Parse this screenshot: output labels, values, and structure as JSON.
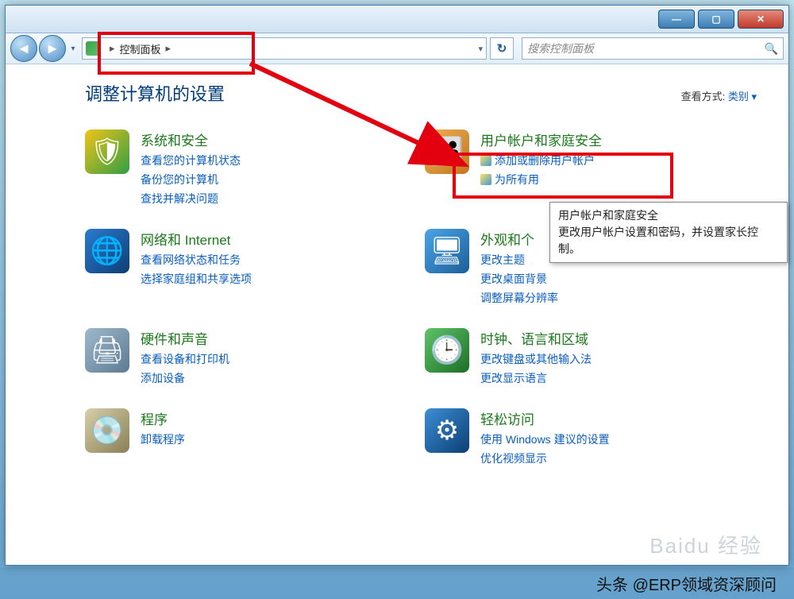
{
  "titlebar": {
    "minimize_glyph": "—",
    "maximize_glyph": "▢",
    "close_glyph": "✕"
  },
  "toolbar": {
    "back_glyph": "◄",
    "fwd_glyph": "►",
    "history_caret": "▾",
    "breadcrumb_root": "控制面板",
    "breadcrumb_sep": "▸",
    "address_caret": "▾",
    "refresh_glyph": "↻",
    "search_placeholder": "搜索控制面板",
    "search_glyph": "🔍"
  },
  "header": {
    "title": "调整计算机的设置",
    "viewby_label": "查看方式:",
    "viewby_value": "类别 ▾"
  },
  "categories": {
    "system": {
      "title": "系统和安全",
      "links": [
        "查看您的计算机状态",
        "备份您的计算机",
        "查找并解决问题"
      ]
    },
    "network": {
      "title": "网络和 Internet",
      "links": [
        "查看网络状态和任务",
        "选择家庭组和共享选项"
      ]
    },
    "hardware": {
      "title": "硬件和声音",
      "links": [
        "查看设备和打印机",
        "添加设备"
      ]
    },
    "programs": {
      "title": "程序",
      "links": [
        "卸载程序"
      ]
    },
    "users": {
      "title": "用户帐户和家庭安全",
      "links": [
        "添加或删除用户帐户",
        "为所有用"
      ]
    },
    "appearance": {
      "title": "外观和个",
      "links": [
        "更改主题",
        "更改桌面背景",
        "调整屏幕分辨率"
      ]
    },
    "clock": {
      "title": "时钟、语言和区域",
      "links": [
        "更改键盘或其他输入法",
        "更改显示语言"
      ]
    },
    "ease": {
      "title": "轻松访问",
      "links": [
        "使用 Windows 建议的设置",
        "优化视频显示"
      ]
    }
  },
  "tooltip": {
    "title": "用户帐户和家庭安全",
    "body": "更改用户帐户设置和密码，并设置家长控制。"
  },
  "caption": "头条 @ERP领域资深顾问",
  "watermark": "Baidu 经验"
}
